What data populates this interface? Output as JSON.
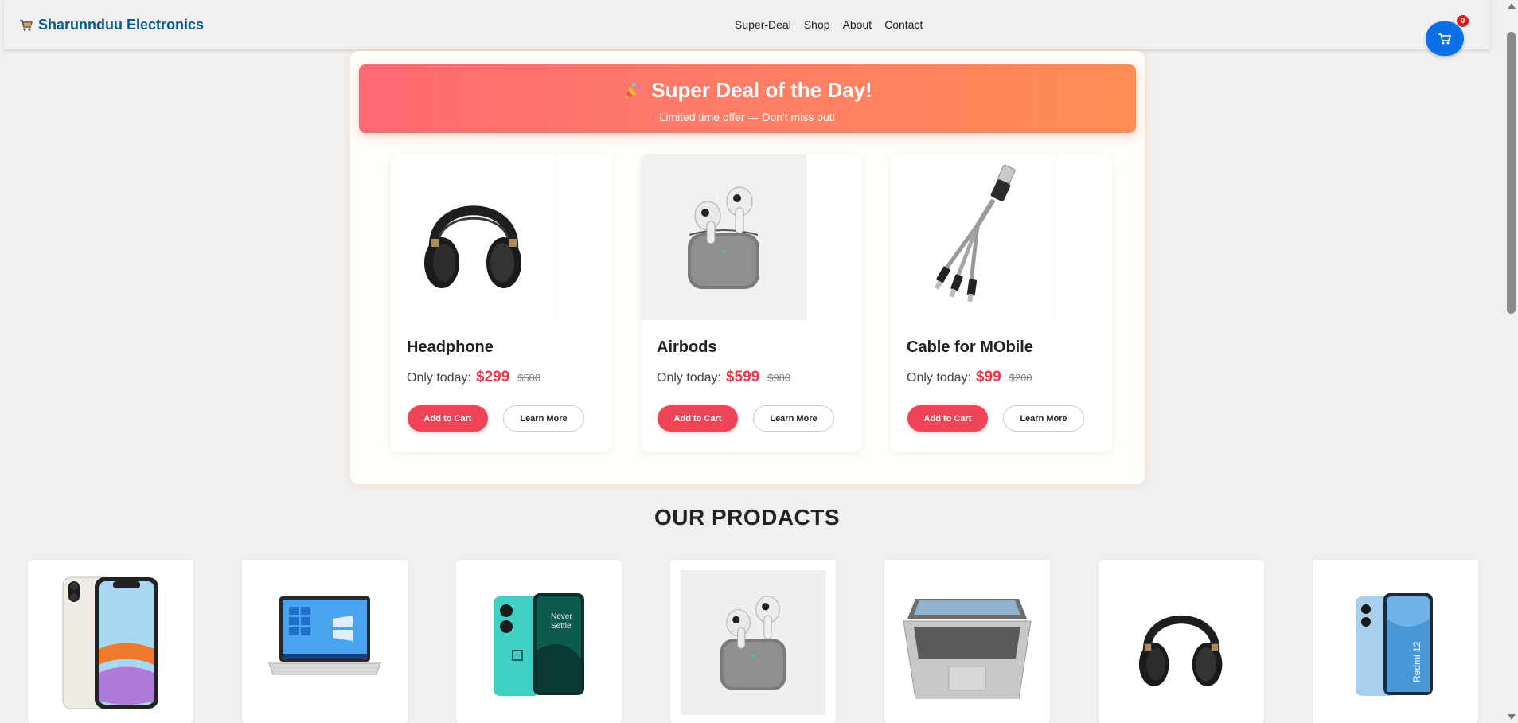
{
  "navbar": {
    "brand": "Sharunnduu Electronics",
    "brand_icon": "cart-icon",
    "links": [
      "Super-Deal",
      "Shop",
      "About",
      "Contact"
    ],
    "cart_count": "0"
  },
  "deal": {
    "title": "Super Deal of the Day!",
    "subtitle": "Limited time offer — Don't miss out!",
    "cards": [
      {
        "name": "Headphone",
        "price_label": "Only today:",
        "price": "$299",
        "old_price": "$580",
        "add_label": "Add to Cart",
        "learn_label": "Learn More",
        "image": "headphone"
      },
      {
        "name": "Airbods",
        "price_label": "Only today:",
        "price": "$599",
        "old_price": "$980",
        "add_label": "Add to Cart",
        "learn_label": "Learn More",
        "image": "airbuds"
      },
      {
        "name": "Cable for MObile",
        "price_label": "Only today:",
        "price": "$99",
        "old_price": "$200",
        "add_label": "Add to Cart",
        "learn_label": "Learn More",
        "image": "cable"
      }
    ]
  },
  "products": {
    "title": "OUR PRODACTS",
    "items": [
      "iphone",
      "laptop-windows",
      "oneplus-phone",
      "airbuds",
      "laptop-silver",
      "headphone",
      "redmi-phone"
    ]
  },
  "colors": {
    "brand": "#0b5c8e",
    "accent": "#ee4456",
    "price": "#e8394a",
    "cart_button": "#0b6fe8"
  }
}
